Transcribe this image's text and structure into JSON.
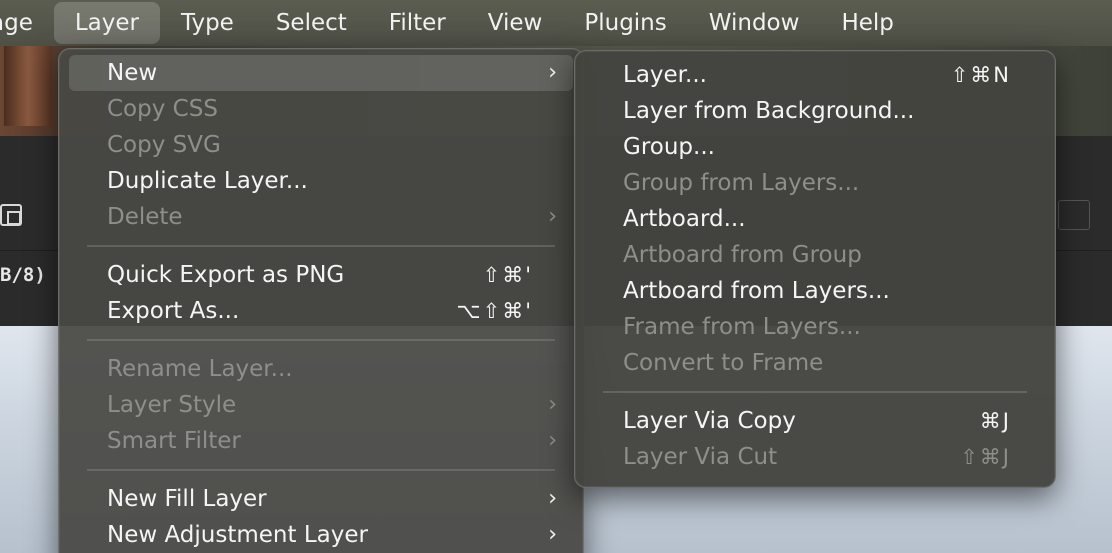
{
  "menubar": {
    "items": [
      {
        "label": "age"
      },
      {
        "label": "Layer"
      },
      {
        "label": "Type"
      },
      {
        "label": "Select"
      },
      {
        "label": "Filter"
      },
      {
        "label": "View"
      },
      {
        "label": "Plugins"
      },
      {
        "label": "Window"
      },
      {
        "label": "Help"
      }
    ],
    "active": "Layer"
  },
  "background": {
    "doc_label": "B/8)"
  },
  "layer_menu": {
    "items": [
      {
        "label": "New",
        "enabled": true,
        "submenu": true,
        "highlighted": true
      },
      {
        "label": "Copy CSS",
        "enabled": false
      },
      {
        "label": "Copy SVG",
        "enabled": false
      },
      {
        "label": "Duplicate Layer...",
        "enabled": true
      },
      {
        "label": "Delete",
        "enabled": false,
        "submenu": true
      },
      {
        "label": "Quick Export as PNG",
        "enabled": true,
        "shortcut": "⇧⌘'"
      },
      {
        "label": "Export As...",
        "enabled": true,
        "shortcut": "⌥⇧⌘'"
      },
      {
        "label": "Rename Layer...",
        "enabled": false
      },
      {
        "label": "Layer Style",
        "enabled": false,
        "submenu": true
      },
      {
        "label": "Smart Filter",
        "enabled": false,
        "submenu": true
      },
      {
        "label": "New Fill Layer",
        "enabled": true,
        "submenu": true
      },
      {
        "label": "New Adjustment Layer",
        "enabled": true,
        "submenu": true
      }
    ],
    "chevron": "›"
  },
  "new_submenu": {
    "items": [
      {
        "label": "Layer...",
        "enabled": true,
        "shortcut": "⇧⌘N"
      },
      {
        "label": "Layer from Background...",
        "enabled": true
      },
      {
        "label": "Group...",
        "enabled": true
      },
      {
        "label": "Group from Layers...",
        "enabled": false
      },
      {
        "label": "Artboard...",
        "enabled": true
      },
      {
        "label": "Artboard from Group",
        "enabled": false
      },
      {
        "label": "Artboard from Layers...",
        "enabled": true
      },
      {
        "label": "Frame from Layers...",
        "enabled": false
      },
      {
        "label": "Convert to Frame",
        "enabled": false
      },
      {
        "label": "Layer Via Copy",
        "enabled": true,
        "shortcut": "⌘J"
      },
      {
        "label": "Layer Via Cut",
        "enabled": false,
        "shortcut": "⇧⌘J"
      }
    ]
  }
}
